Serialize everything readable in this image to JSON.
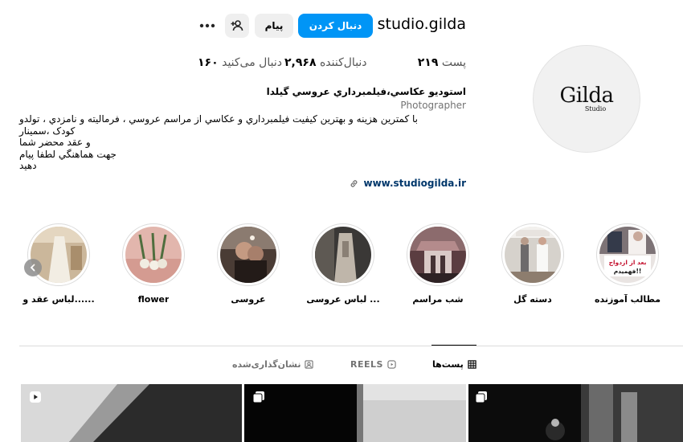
{
  "profile": {
    "username": "studio.gilda",
    "follow_label": "دنبال کردن",
    "message_label": "پیام",
    "avatar_logo": "Gilda",
    "avatar_sub": "Studio",
    "stats": {
      "posts_count": "۲۱۹",
      "posts_label": "پست",
      "followers_count": "۲,۹۶۸",
      "followers_label": "دنبال‌کننده",
      "following_count": "۱۶۰",
      "following_label": "دنبال می‌کنید"
    },
    "bio": {
      "name": "استوديو عکاسي،فيلمبرداري عروسي گيلدا",
      "category": "Photographer",
      "lines": [
        "با کمترين هزينه و بهترين کيفيت فيلمبرداري و عکاسي از مراسم عروسي ، فرماليته و نامزدي ، تولدو",
        "کودک ،سمينار",
        "و عقد محضر شما",
        "جهت هماهنگي لطفا پيام",
        "دهيد"
      ],
      "link": "www.studiogilda.ir"
    }
  },
  "highlights": [
    {
      "label": "مطالب آموزنده",
      "icon": "education-highlight"
    },
    {
      "label": "دسته گل",
      "icon": "bouquet-highlight"
    },
    {
      "label": "شب مراسم",
      "icon": "ceremony-highlight"
    },
    {
      "label": "لباس عروسی ...",
      "icon": "wedding-dress-highlight"
    },
    {
      "label": "عروسی",
      "icon": "wedding-highlight"
    },
    {
      "label": "flower",
      "icon": "flower-highlight"
    },
    {
      "label": "لباس عقد و......",
      "icon": "engagement-dress-highlight"
    }
  ],
  "highlight_badge": {
    "line1": "بعد از ازدواج",
    "line2": "فهمیدم!!"
  },
  "tabs": [
    {
      "label": "پست‌ها",
      "icon": "grid-icon",
      "active": true
    },
    {
      "label": "REELS",
      "icon": "reels-icon",
      "active": false
    },
    {
      "label": "نشان‌گذاری‌شده",
      "icon": "tagged-icon",
      "active": false
    }
  ],
  "colors": {
    "accent": "#0095f6",
    "link": "#00376b",
    "muted": "#737373",
    "secondary_button": "#efefef"
  }
}
